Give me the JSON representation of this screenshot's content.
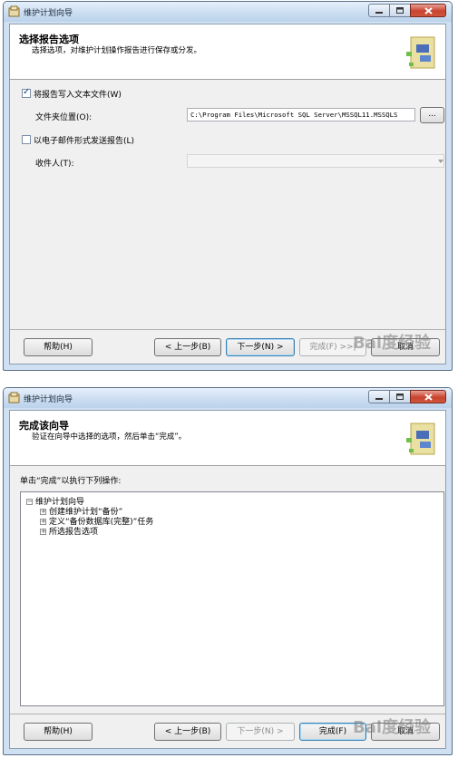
{
  "window1": {
    "title": "维护计划向导",
    "header_title": "选择报告选项",
    "header_subtitle": "选择选项，对维护计划操作报告进行保存或分发。",
    "write_to_file_label": "将报告写入文本文件(W)",
    "write_to_file_checked": true,
    "folder_label": "文件夹位置(O):",
    "folder_value": "C:\\Program Files\\Microsoft SQL Server\\MSSQL11.MSSQLS",
    "browse_label": "...",
    "email_label": "以电子邮件形式发送报告(L)",
    "email_checked": false,
    "recipient_label": "收件人(T):",
    "recipient_value": "",
    "buttons": {
      "help": "帮助(H)",
      "back": "< 上一步(B)",
      "next": "下一步(N) >",
      "finish": "完成(F) >>|",
      "cancel": "取消"
    }
  },
  "window2": {
    "title": "维护计划向导",
    "header_title": "完成该向导",
    "header_subtitle": "验证在向导中选择的选项，然后单击“完成”。",
    "instruction": "单击“完成”以执行下列操作:",
    "tree": {
      "root": "维护计划向导",
      "children": [
        "创建维护计划“备份”",
        "定义“备份数据库(完整)”任务",
        "所选报告选项"
      ]
    },
    "buttons": {
      "help": "帮助(H)",
      "back": "< 上一步(B)",
      "next": "下一步(N) >",
      "finish": "完成(F)",
      "cancel": "取消"
    }
  },
  "watermark": "Bai度经验",
  "colors": {
    "accent": "#3c7fb1",
    "close_button": "#c8442f",
    "titlebar": "#c9dcf0"
  }
}
